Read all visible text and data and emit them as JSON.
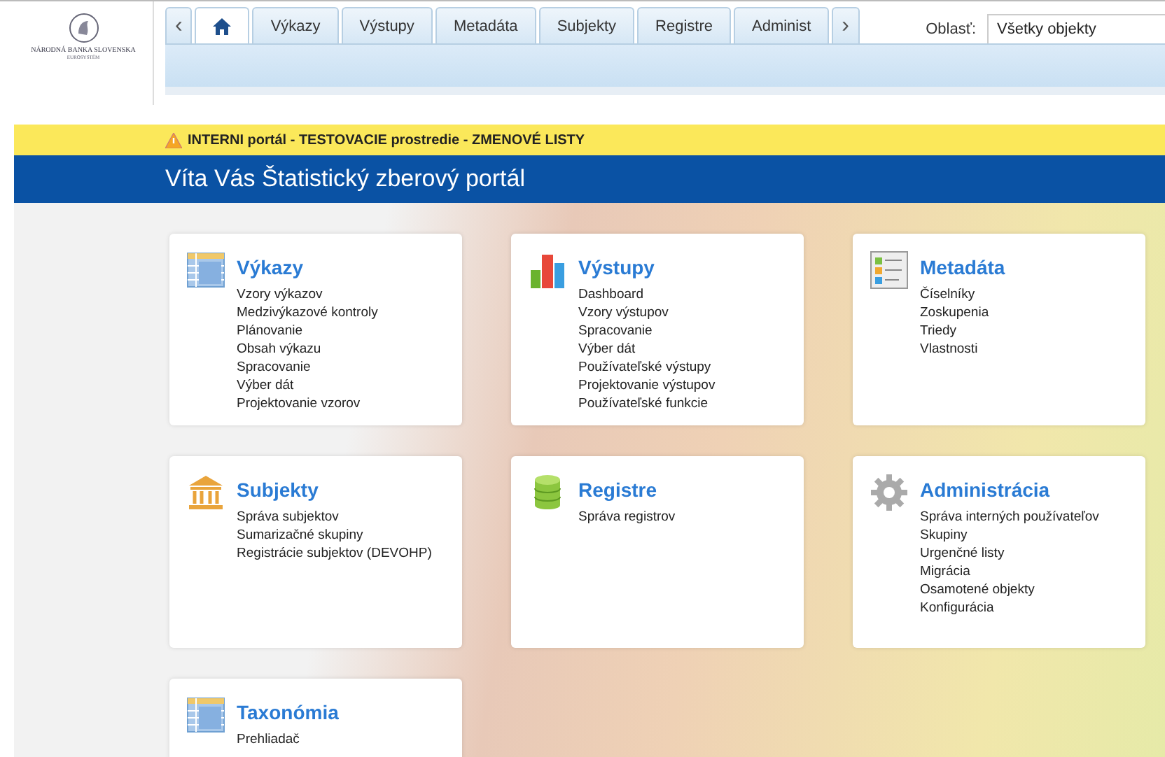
{
  "logo": {
    "name": "NÁRODNÁ BANKA SLOVENSKA",
    "subtitle": "EUROSYSTÉM"
  },
  "tabs": [
    {
      "kind": "prev",
      "label": "‹",
      "selected": false
    },
    {
      "kind": "home",
      "selected": true
    },
    {
      "kind": "text",
      "label": "Výkazy",
      "selected": false
    },
    {
      "kind": "text",
      "label": "Výstupy",
      "selected": false
    },
    {
      "kind": "text",
      "label": "Metadáta",
      "selected": false
    },
    {
      "kind": "text",
      "label": "Subjekty",
      "selected": false
    },
    {
      "kind": "text",
      "label": "Registre",
      "selected": false
    },
    {
      "kind": "text",
      "label": "Administ",
      "selected": false
    },
    {
      "kind": "next",
      "label": "›",
      "selected": false
    }
  ],
  "area": {
    "label": "Oblasť:",
    "value": "Všetky objekty"
  },
  "warning": "INTERNI portál - TESTOVACIE prostredie - ZMENOVÉ LISTY",
  "title": "Víta Vás Štatistický zberový portál",
  "cards": [
    {
      "kind": "table",
      "title": "Výkazy",
      "items": [
        "Vzory výkazov",
        "Medzivýkazové kontroly",
        "Plánovanie",
        "Obsah výkazu",
        "Spracovanie",
        "Výber dát",
        "Projektovanie vzorov"
      ]
    },
    {
      "kind": "chart",
      "title": "Výstupy",
      "items": [
        "Dashboard",
        "Vzory výstupov",
        "Spracovanie",
        "Výber dát",
        "Používateľské výstupy",
        "Projektovanie výstupov",
        "Používateľské funkcie"
      ]
    },
    {
      "kind": "list",
      "title": "Metadáta",
      "items": [
        "Číselníky",
        "Zoskupenia",
        "Triedy",
        "Vlastnosti"
      ]
    },
    {
      "kind": "building",
      "title": "Subjekty",
      "items": [
        "Správa subjektov",
        "Sumarizačné skupiny",
        "Registrácie subjektov (DEVOHP)"
      ]
    },
    {
      "kind": "database",
      "title": "Registre",
      "items": [
        "Správa registrov"
      ]
    },
    {
      "kind": "gear",
      "title": "Administrácia",
      "items": [
        "Správa interných používateľov",
        "Skupiny",
        "Urgenčné listy",
        "Migrácia",
        "Osamotené objekty",
        "Konfigurácia"
      ]
    },
    {
      "kind": "table",
      "title": "Taxonómia",
      "items": [
        "Prehliadač"
      ]
    }
  ]
}
